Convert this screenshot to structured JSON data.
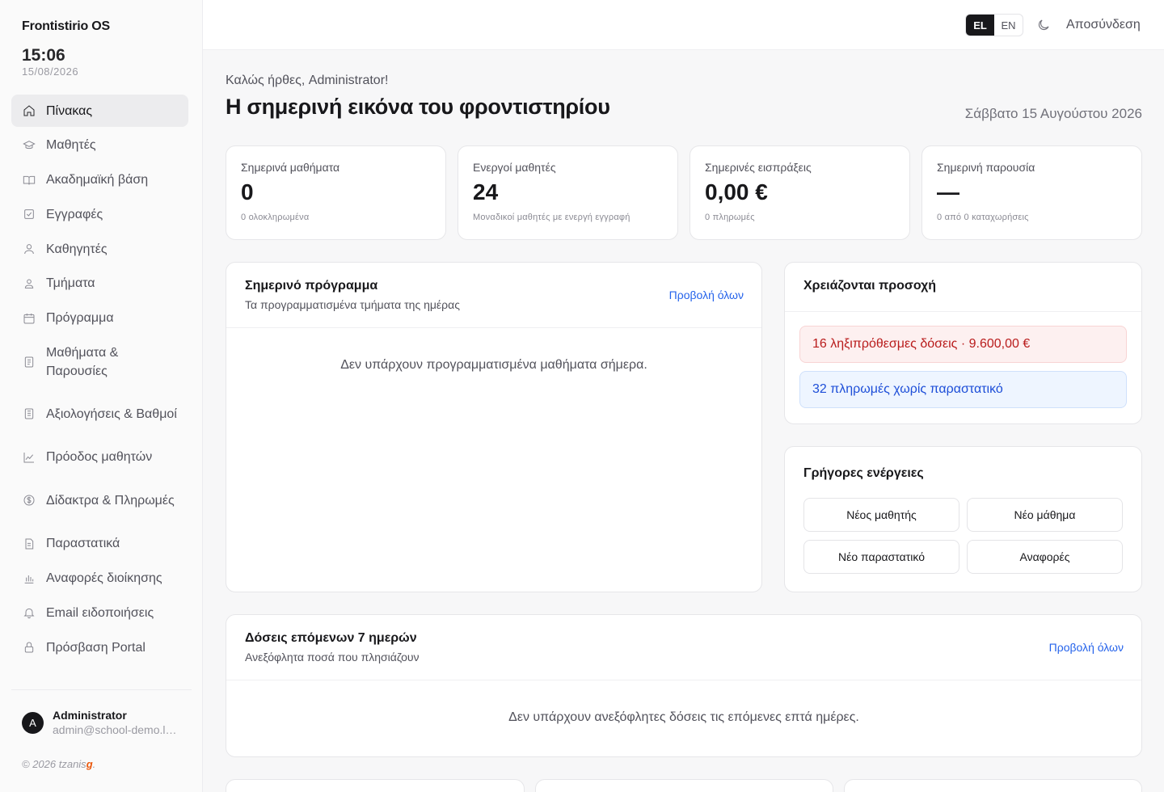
{
  "app": {
    "name": "Frontistirio OS",
    "time": "15:06",
    "date": "15/08/2026"
  },
  "sidebar": {
    "items": [
      {
        "label": "Πίνακας",
        "icon": "home-icon"
      },
      {
        "label": "Μαθητές",
        "icon": "graduation-cap-icon"
      },
      {
        "label": "Ακαδημαϊκή βάση",
        "icon": "book-open-icon"
      },
      {
        "label": "Εγγραφές",
        "icon": "check-square-icon"
      },
      {
        "label": "Καθηγητές",
        "icon": "user-icon"
      },
      {
        "label": "Τμήματα",
        "icon": "users-icon"
      },
      {
        "label": "Πρόγραμμα",
        "icon": "calendar-icon"
      },
      {
        "label": "Μαθήματα & Παρουσίες",
        "icon": "clipboard-icon"
      },
      {
        "label": "Αξιολογήσεις & Βαθμοί",
        "icon": "clipboard-list-icon"
      },
      {
        "label": "Πρόοδος μαθητών",
        "icon": "line-chart-icon"
      },
      {
        "label": "Δίδακτρα & Πληρωμές",
        "icon": "dollar-circle-icon"
      },
      {
        "label": "Παραστατικά",
        "icon": "file-text-icon"
      },
      {
        "label": "Αναφορές διοίκησης",
        "icon": "bar-chart-icon"
      },
      {
        "label": "Email ειδοποιήσεις",
        "icon": "bell-icon"
      },
      {
        "label": "Πρόσβαση Portal",
        "icon": "lock-icon"
      }
    ],
    "user": {
      "initial": "A",
      "name": "Administrator",
      "email": "admin@school-demo.local"
    },
    "copyright": {
      "prefix": "© 2026 tzanis",
      "highlight": "g",
      "suffix": "."
    }
  },
  "topbar": {
    "lang_el": "EL",
    "lang_en": "EN",
    "logout": "Αποσύνδεση"
  },
  "header": {
    "greeting": "Καλώς ήρθες, Administrator!",
    "title": "Η σημερινή εικόνα του φροντιστηρίου",
    "date": "Σάββατο 15 Αυγούστου 2026"
  },
  "stats": [
    {
      "label": "Σημερινά μαθήματα",
      "value": "0",
      "sub": "0 ολοκληρωμένα"
    },
    {
      "label": "Ενεργοί μαθητές",
      "value": "24",
      "sub": "Μοναδικοί μαθητές με ενεργή εγγραφή"
    },
    {
      "label": "Σημερινές εισπράξεις",
      "value": "0,00 €",
      "sub": "0 πληρωμές"
    },
    {
      "label": "Σημερινή παρουσία",
      "value": "—",
      "sub": "0 από 0 καταχωρήσεις"
    }
  ],
  "schedule": {
    "title": "Σημερινό πρόγραμμα",
    "subtitle": "Τα προγραμματισμένα τμήματα της ημέρας",
    "link": "Προβολή όλων",
    "empty": "Δεν υπάρχουν προγραμματισμένα μαθήματα σήμερα."
  },
  "attention": {
    "title": "Χρειάζονται προσοχή",
    "overdue": "16 ληξιπρόθεσμες δόσεις · 9.600,00 €",
    "no_receipt": "32 πληρωμές χωρίς παραστατικό"
  },
  "quick_actions": {
    "title": "Γρήγορες ενέργειες",
    "new_student": "Νέος μαθητής",
    "new_lesson": "Νέο μάθημα",
    "new_receipt": "Νέο παραστατικό",
    "reports": "Αναφορές"
  },
  "installments": {
    "title": "Δόσεις επόμενων 7 ημερών",
    "subtitle": "Ανεξόφλητα ποσά που πλησιάζουν",
    "link": "Προβολή όλων",
    "empty": "Δεν υπάρχουν ανεξόφλητες δόσεις τις επόμενες επτά ημέρες."
  }
}
